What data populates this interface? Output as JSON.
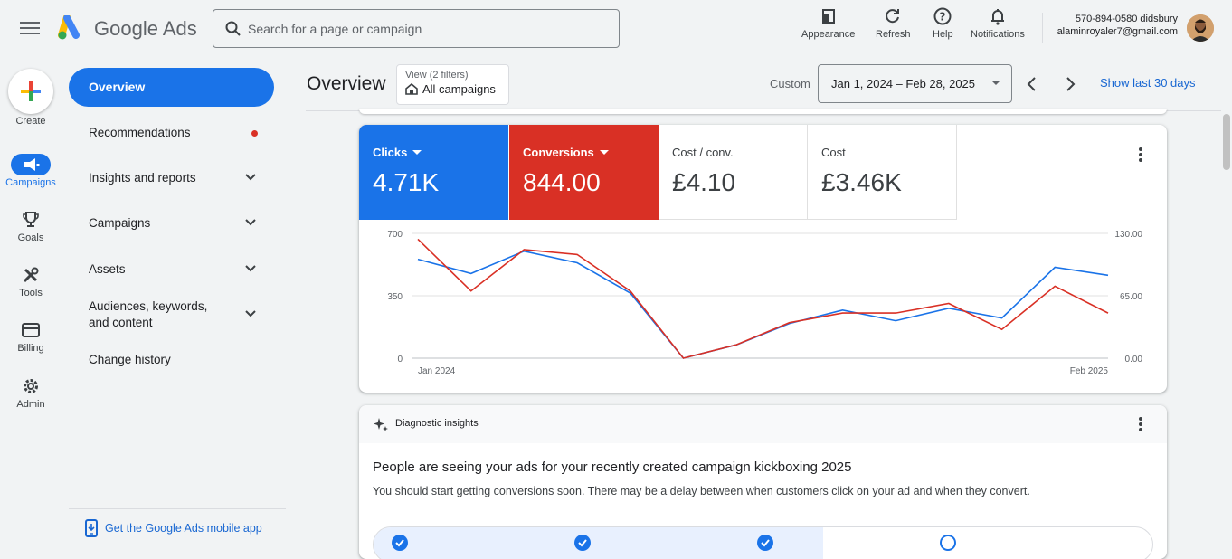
{
  "app": {
    "name": "Google Ads"
  },
  "search": {
    "placeholder": "Search for a page or campaign",
    "value": ""
  },
  "toolbar": {
    "appearance": "Appearance",
    "refresh": "Refresh",
    "help": "Help",
    "notifications": "Notifications"
  },
  "account": {
    "line1": "570-894-0580 didsbury",
    "line2": "alaminroyaler7@gmail.com"
  },
  "rail": {
    "create": "Create",
    "items": [
      {
        "label": "Campaigns",
        "icon": "megaphone-icon",
        "active": true
      },
      {
        "label": "Goals",
        "icon": "trophy-icon",
        "active": false
      },
      {
        "label": "Tools",
        "icon": "tools-icon",
        "active": false
      },
      {
        "label": "Billing",
        "icon": "credit-card-icon",
        "active": false
      },
      {
        "label": "Admin",
        "icon": "gear-icon",
        "active": false
      }
    ]
  },
  "nav": {
    "items": [
      {
        "label": "Overview",
        "active": true
      },
      {
        "label": "Recommendations",
        "badge": true
      },
      {
        "label": "Insights and reports",
        "expandable": true
      },
      {
        "label": "Campaigns",
        "expandable": true
      },
      {
        "label": "Assets",
        "expandable": true
      },
      {
        "label": "Audiences, keywords, and content",
        "expandable": true
      },
      {
        "label": "Change history"
      }
    ],
    "mobile_app": "Get the Google Ads mobile app"
  },
  "header": {
    "title": "Overview",
    "view_label": "View (2 filters)",
    "view_value": "All campaigns",
    "custom_label": "Custom",
    "date_range": "Jan 1, 2024 – Feb 28, 2025",
    "show_last": "Show last 30 days"
  },
  "metrics": [
    {
      "label": "Clicks",
      "value": "4.71K",
      "color": "#1a73e8",
      "selected": true
    },
    {
      "label": "Conversions",
      "value": "844.00",
      "color": "#d93025",
      "selected": true
    },
    {
      "label": "Cost / conv.",
      "value": "£4.10",
      "selected": false
    },
    {
      "label": "Cost",
      "value": "£3.46K",
      "selected": false
    }
  ],
  "chart_data": {
    "type": "line",
    "x_tick_labels": [
      "Jan 2024",
      "Feb 2025"
    ],
    "y_left_ticks": [
      "700",
      "350",
      "0"
    ],
    "y_right_ticks": [
      "130.00",
      "65.00",
      "0.00"
    ],
    "ylim_left": [
      0,
      700
    ],
    "ylim_right": [
      0,
      130
    ],
    "grid": true,
    "series": [
      {
        "name": "Clicks",
        "axis": "left",
        "color": "#1a73e8",
        "values": [
          555,
          475,
          600,
          535,
          365,
          0,
          75,
          195,
          270,
          210,
          280,
          225,
          510,
          465
        ]
      },
      {
        "name": "Conversions",
        "axis": "right",
        "color": "#d93025",
        "values": [
          124,
          70,
          113,
          108,
          70,
          0,
          14,
          37,
          47,
          47,
          57,
          30,
          75,
          47
        ]
      }
    ]
  },
  "diagnostic": {
    "header": "Diagnostic insights",
    "title": "People are seeing your ads for your recently created campaign kickboxing 2025",
    "subtitle": "You should start getting conversions soon. There may be a delay between when customers click on your ad and when they convert.",
    "steps_done": 3,
    "steps_total": 4
  }
}
